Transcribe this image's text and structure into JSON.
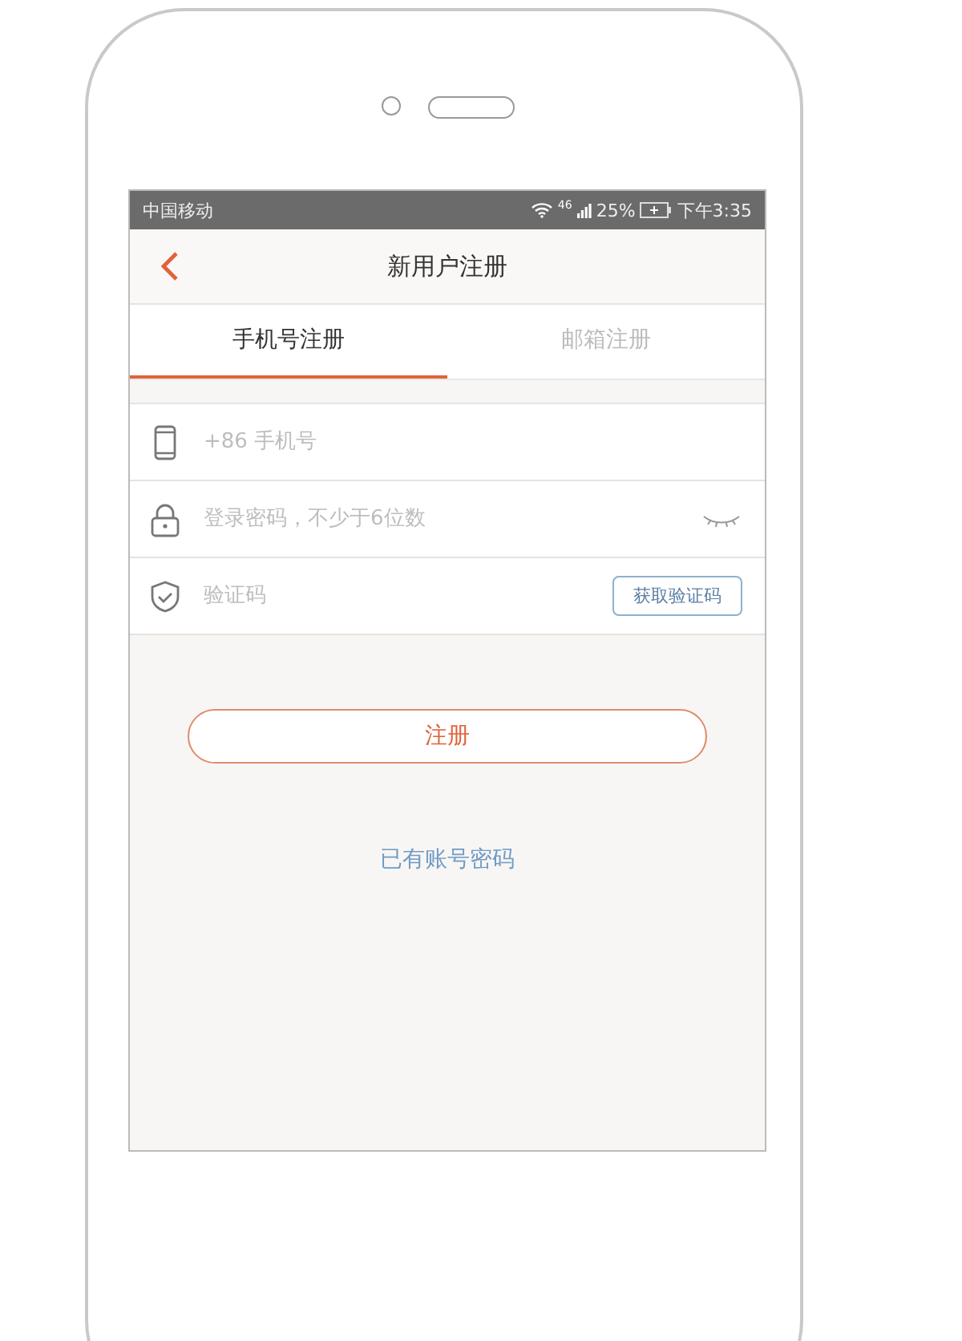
{
  "status_bar": {
    "carrier": "中国移动",
    "network": "46",
    "battery": "25%",
    "time": "下午3:35"
  },
  "nav": {
    "title": "新用户注册"
  },
  "tabs": [
    {
      "label": "手机号注册",
      "selected": true
    },
    {
      "label": "邮箱注册",
      "selected": false
    }
  ],
  "fields": [
    {
      "kind": "phone",
      "placeholder": "+86 手机号"
    },
    {
      "kind": "password",
      "placeholder": "登录密码，不少于6位数"
    },
    {
      "kind": "code",
      "placeholder": "验证码",
      "action": "获取验证码"
    }
  ],
  "submit": "注册",
  "link": "已有账号密码"
}
